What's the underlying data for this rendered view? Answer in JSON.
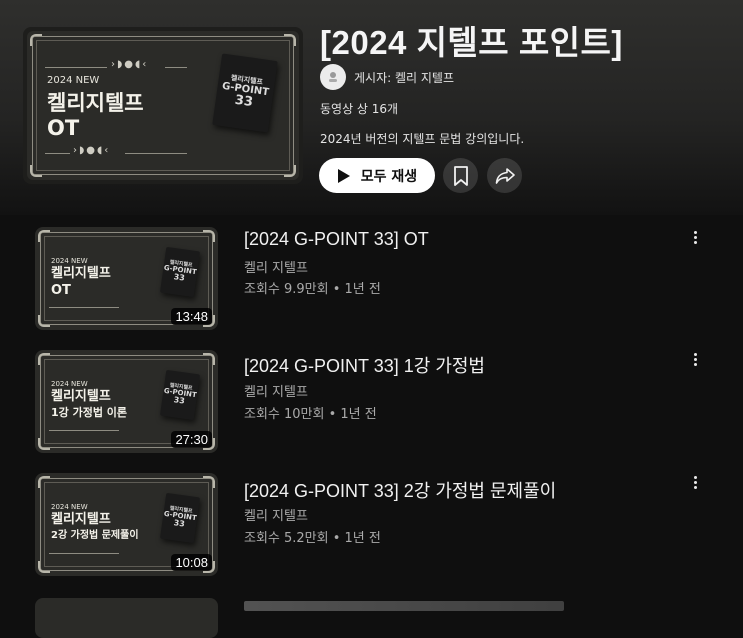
{
  "playlist": {
    "title": "[2024 지텔프 포인트]",
    "uploader": "게시자: 켈리 지텔프",
    "video_count": "동영상 상 16개",
    "description": "2024년 버전의 지텔프 문법 강의입니다.",
    "play_all_label": "모두 재생",
    "cover": {
      "year": "2024 NEW",
      "title_line1": "켈리지텔프",
      "title_line2": "OT",
      "book_line1": "켈리지텔프",
      "book_line2": "G-POINT",
      "book_line3": "33"
    }
  },
  "videos": [
    {
      "title": "[2024 G-POINT 33] OT",
      "channel": "켈리 지텔프",
      "stats": "조회수 9.9만회 • 1년 전",
      "duration": "13:48",
      "thumb_year": "2024 NEW",
      "thumb_line1": "켈리지텔프",
      "thumb_line2": "OT"
    },
    {
      "title": "[2024 G-POINT 33] 1강 가정법",
      "channel": "켈리 지텔프",
      "stats": "조회수 10만회 • 1년 전",
      "duration": "27:30",
      "thumb_year": "2024 NEW",
      "thumb_line1": "켈리지텔프",
      "thumb_line2": "1강 가정법 이론"
    },
    {
      "title": "[2024 G-POINT 33] 2강 가정법 문제풀이",
      "channel": "켈리 지텔프",
      "stats": "조회수 5.2만회 • 1년 전",
      "duration": "10:08",
      "thumb_year": "2024 NEW",
      "thumb_line1": "켈리지텔프",
      "thumb_line2": "2강 가정법 문제풀이"
    }
  ],
  "book": {
    "line1": "켈리지텔프",
    "line2": "G-POINT",
    "line3": "33"
  },
  "icons": {
    "play": "play-icon",
    "save": "bookmark-icon",
    "share": "share-icon",
    "more": "more-vert-icon"
  },
  "colors": {
    "background": "#0f0f0f",
    "hero_top": "#2f2f2d",
    "thumb_bg": "#2b2b28",
    "secondary_text": "#aaaaaa"
  }
}
